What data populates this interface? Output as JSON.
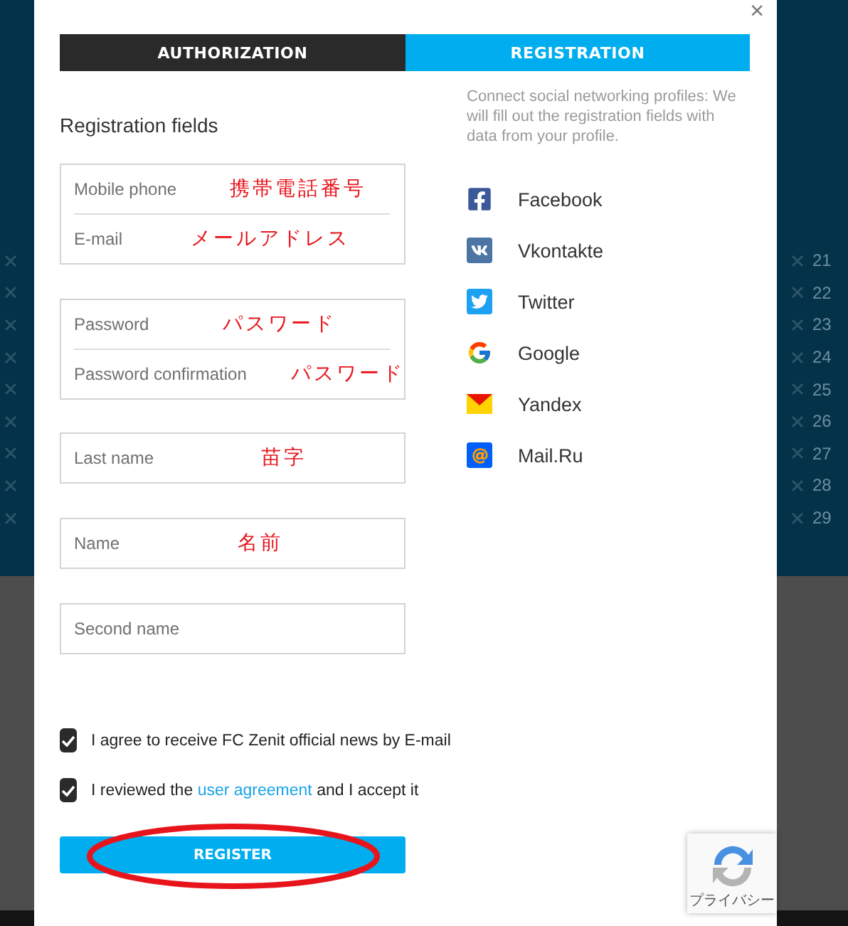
{
  "background": {
    "row_numbers": [
      "21",
      "22",
      "23",
      "24",
      "25",
      "26",
      "27",
      "28",
      "29"
    ]
  },
  "modal": {
    "close": "×",
    "tabs": [
      {
        "label": "AUTHORIZATION",
        "selected": false
      },
      {
        "label": "REGISTRATION",
        "selected": true
      }
    ],
    "form": {
      "heading": "Registration fields",
      "field_groups": [
        {
          "fields": [
            {
              "placeholder": "Mobile phone",
              "annotation": "携帯電話番号"
            },
            {
              "placeholder": "E-mail",
              "annotation": "メールアドレス"
            }
          ]
        },
        {
          "fields": [
            {
              "placeholder": "Password",
              "annotation": "パスワード"
            },
            {
              "placeholder": "Password confirmation",
              "annotation": "パスワード"
            }
          ]
        },
        {
          "fields": [
            {
              "placeholder": "Last name",
              "annotation": "苗字"
            }
          ]
        },
        {
          "fields": [
            {
              "placeholder": "Name",
              "annotation": "名前"
            }
          ]
        },
        {
          "fields": [
            {
              "placeholder": "Second name"
            }
          ]
        }
      ],
      "checkboxes": [
        {
          "text": "I agree to receive FC Zenit official news by E-mail",
          "checked": true
        },
        {
          "text": "I reviewed the",
          "link": "user agreement",
          "text_after": "and I accept it",
          "checked": true
        }
      ],
      "register_button": {
        "label": "REGISTER",
        "circled": true
      }
    },
    "social": {
      "intro": "Connect social networking profiles: We will fill out the registration fields with data from your profile.",
      "networks": [
        {
          "name": "Facebook",
          "kind": "facebook"
        },
        {
          "name": "Vkontakte",
          "kind": "vk"
        },
        {
          "name": "Twitter",
          "kind": "twitter"
        },
        {
          "name": "Google",
          "kind": "google"
        },
        {
          "name": "Yandex",
          "kind": "yandex"
        },
        {
          "name": "Mail.Ru",
          "kind": "mailru"
        }
      ]
    }
  },
  "recaptcha": {
    "label": "プライバシー"
  }
}
